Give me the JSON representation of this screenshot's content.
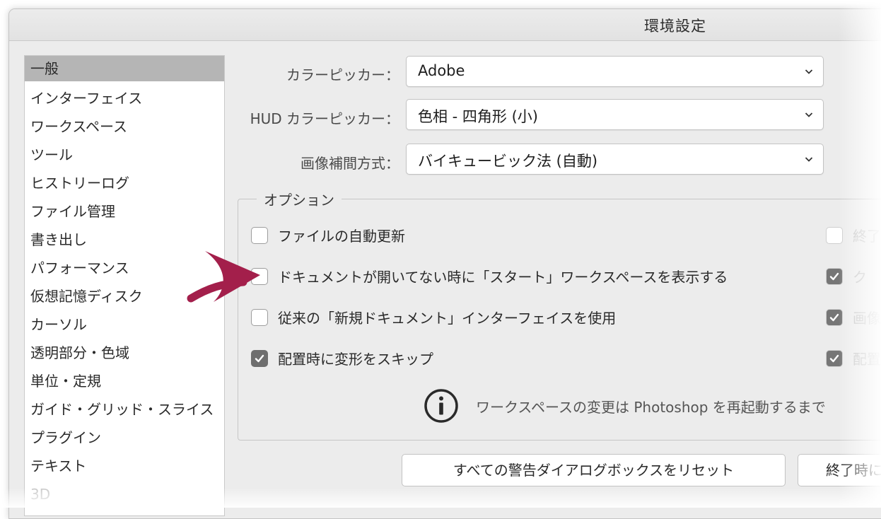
{
  "window": {
    "title": "環境設定"
  },
  "sidebar": {
    "items": [
      {
        "label": "一般"
      },
      {
        "label": "インターフェイス"
      },
      {
        "label": "ワークスペース"
      },
      {
        "label": "ツール"
      },
      {
        "label": "ヒストリーログ"
      },
      {
        "label": "ファイル管理"
      },
      {
        "label": "書き出し"
      },
      {
        "label": "パフォーマンス"
      },
      {
        "label": "仮想記憶ディスク"
      },
      {
        "label": "カーソル"
      },
      {
        "label": "透明部分・色域"
      },
      {
        "label": "単位・定規"
      },
      {
        "label": "ガイド・グリッド・スライス"
      },
      {
        "label": "プラグイン"
      },
      {
        "label": "テキスト"
      },
      {
        "label": "3D"
      }
    ],
    "selected": "一般"
  },
  "general": {
    "color_picker": {
      "label": "カラーピッカー：",
      "value": "Adobe"
    },
    "hud_color_picker": {
      "label": "HUD カラーピッカー：",
      "value": "色相 - 四角形 (小)"
    },
    "interpolation": {
      "label": "画像補間方式：",
      "value": "バイキュービック法 (自動)"
    }
  },
  "options": {
    "legend": "オプション",
    "left": [
      {
        "label": "ファイルの自動更新",
        "checked": false
      },
      {
        "label": "ドキュメントが開いてない時に「スタート」ワークスペースを表示する",
        "checked": false
      },
      {
        "label": "従来の「新規ドキュメント」インターフェイスを使用",
        "checked": false
      },
      {
        "label": "配置時に変形をスキップ",
        "checked": true
      }
    ],
    "right": [
      {
        "label": "終了",
        "checked": false
      },
      {
        "label": "ク",
        "checked": true
      },
      {
        "label": "画像",
        "checked": true
      },
      {
        "label": "配置",
        "checked": true
      }
    ],
    "info_text": "ワークスペースの変更は Photoshop を再起動するまで"
  },
  "buttons": {
    "reset_warnings": "すべての警告ダイアログボックスをリセット",
    "quit_reset": "終了時に"
  },
  "colors": {
    "annotation_arrow": "#a31f4b",
    "checkbox_checked": "#6e6e6e",
    "sidebar_selected": "#b5b5b5"
  }
}
